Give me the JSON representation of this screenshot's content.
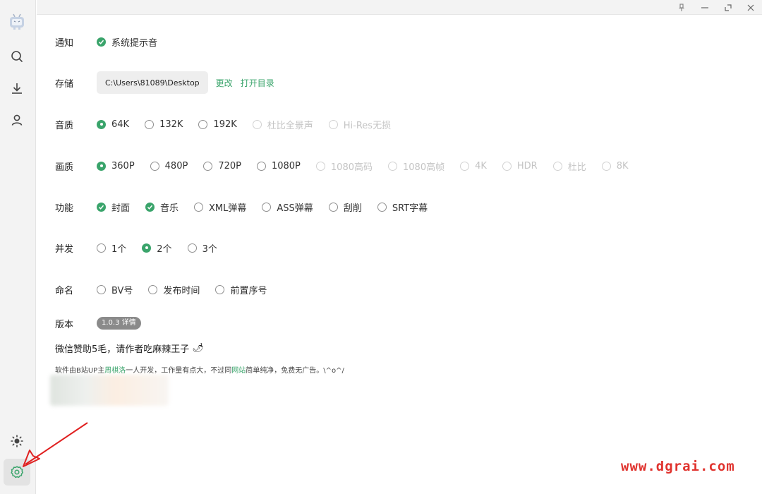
{
  "settings": {
    "notify": {
      "label": "通知",
      "options": [
        {
          "text": "系统提示音",
          "checked": true
        }
      ]
    },
    "storage": {
      "label": "存储",
      "path": "C:\\Users\\81089\\Desktop",
      "change": "更改",
      "open": "打开目录"
    },
    "audio": {
      "label": "音质",
      "options": [
        {
          "text": "64K",
          "checked": true,
          "disabled": false
        },
        {
          "text": "132K",
          "checked": false,
          "disabled": false
        },
        {
          "text": "192K",
          "checked": false,
          "disabled": false
        },
        {
          "text": "杜比全景声",
          "checked": false,
          "disabled": true
        },
        {
          "text": "Hi-Res无损",
          "checked": false,
          "disabled": true
        }
      ]
    },
    "video": {
      "label": "画质",
      "options": [
        {
          "text": "360P",
          "checked": true,
          "disabled": false
        },
        {
          "text": "480P",
          "checked": false,
          "disabled": false
        },
        {
          "text": "720P",
          "checked": false,
          "disabled": false
        },
        {
          "text": "1080P",
          "checked": false,
          "disabled": false
        },
        {
          "text": "1080高码",
          "checked": false,
          "disabled": true
        },
        {
          "text": "1080高帧",
          "checked": false,
          "disabled": true
        },
        {
          "text": "4K",
          "checked": false,
          "disabled": true
        },
        {
          "text": "HDR",
          "checked": false,
          "disabled": true
        },
        {
          "text": "杜比",
          "checked": false,
          "disabled": true
        },
        {
          "text": "8K",
          "checked": false,
          "disabled": true
        }
      ]
    },
    "features": {
      "label": "功能",
      "options": [
        {
          "text": "封面",
          "checked": true
        },
        {
          "text": "音乐",
          "checked": true
        },
        {
          "text": "XML弹幕",
          "checked": false
        },
        {
          "text": "ASS弹幕",
          "checked": false
        },
        {
          "text": "刮削",
          "checked": false
        },
        {
          "text": "SRT字幕",
          "checked": false
        }
      ]
    },
    "concurrency": {
      "label": "并发",
      "options": [
        {
          "text": "1个",
          "checked": false
        },
        {
          "text": "2个",
          "checked": true
        },
        {
          "text": "3个",
          "checked": false
        }
      ]
    },
    "naming": {
      "label": "命名",
      "options": [
        {
          "text": "BV号",
          "checked": false
        },
        {
          "text": "发布时间",
          "checked": false
        },
        {
          "text": "前置序号",
          "checked": false
        }
      ]
    },
    "version": {
      "label": "版本",
      "badge": "1.0.3 详情"
    }
  },
  "donate": {
    "title": "微信赞助5毛，请作者吃麻辣王子",
    "emoji": "🌶"
  },
  "credit": {
    "p1": "软件由B站UP主",
    "author": "周棋洛",
    "p2": "一人开发，工作量有点大，不过同",
    "site": "网站",
    "p3": "简单纯净，免费无广告。\\^o^/"
  },
  "watermark": "www.dgrai.com",
  "sidebar": {
    "items": [
      "logo-icon",
      "search-icon",
      "download-icon",
      "user-icon",
      "theme-icon",
      "settings-icon"
    ]
  },
  "colors": {
    "accent": "#3aa46b",
    "watermark": "#e0332e",
    "arrow": "#e02020"
  }
}
